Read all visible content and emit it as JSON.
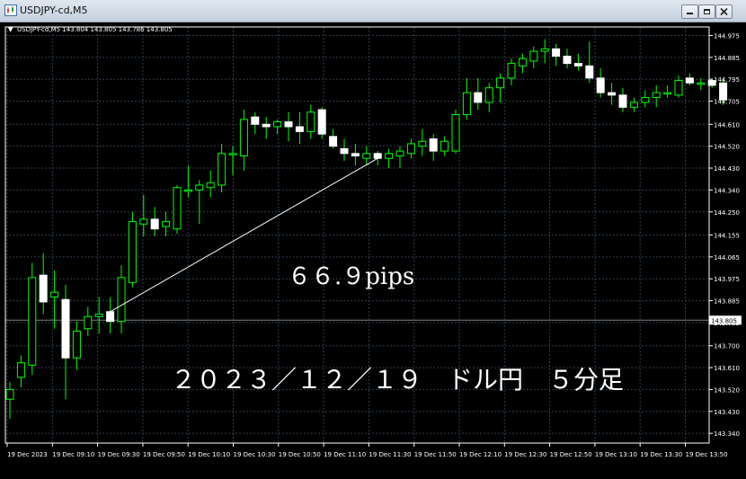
{
  "window": {
    "title": "USDJPY-cd,M5",
    "buttons": [
      "minimize",
      "restore",
      "close"
    ]
  },
  "colors": {
    "background": "#000000",
    "grid": "#2f3f4f",
    "bull_body": "#000000",
    "bull_edge": "#00ff00",
    "bear_body": "#ffffff",
    "wick": "#00ff00",
    "text": "#ffffff",
    "trendline": "#ffffff",
    "current_price_line": "#808080"
  },
  "symbol_info": {
    "arrow": "▼",
    "text": "USDJPY-cd,M5  143.804 143.805 143.786 143.805"
  },
  "annotations": {
    "pips": "６６.９pips",
    "caption": "２０２３／１２／１９　ドル円　５分足"
  },
  "current_price_label": "143.805",
  "chart_data": {
    "type": "candlestick",
    "title": "",
    "ylim": [
      143.3,
      145.01
    ],
    "y_ticks": [
      "144.975",
      "144.885",
      "144.795",
      "144.705",
      "144.610",
      "144.520",
      "144.430",
      "144.340",
      "144.250",
      "144.155",
      "144.065",
      "143.975",
      "143.885",
      "143.795",
      "143.700",
      "143.610",
      "143.520",
      "143.430",
      "143.340"
    ],
    "x_labels": [
      "19 Dec 2023",
      "19 Dec 09:10",
      "19 Dec 09:30",
      "19 Dec 09:50",
      "19 Dec 10:10",
      "19 Dec 10:30",
      "19 Dec 10:50",
      "19 Dec 11:10",
      "19 Dec 11:30",
      "19 Dec 11:50",
      "19 Dec 12:10",
      "19 Dec 12:30",
      "19 Dec 12:50",
      "19 Dec 13:10",
      "19 Dec 13:30",
      "19 Dec 13:50"
    ],
    "grid": true,
    "current_price": 143.805,
    "candles": [
      {
        "o": 143.48,
        "h": 143.55,
        "l": 143.4,
        "c": 143.52
      },
      {
        "o": 143.57,
        "h": 143.66,
        "l": 143.53,
        "c": 143.63
      },
      {
        "o": 143.62,
        "h": 144.04,
        "l": 143.58,
        "c": 143.98
      },
      {
        "o": 143.99,
        "h": 144.08,
        "l": 143.83,
        "c": 143.88
      },
      {
        "o": 143.9,
        "h": 144.01,
        "l": 143.77,
        "c": 143.92
      },
      {
        "o": 143.89,
        "h": 143.95,
        "l": 143.48,
        "c": 143.65
      },
      {
        "o": 143.65,
        "h": 143.8,
        "l": 143.6,
        "c": 143.76
      },
      {
        "o": 143.77,
        "h": 143.86,
        "l": 143.74,
        "c": 143.82
      },
      {
        "o": 143.82,
        "h": 143.9,
        "l": 143.75,
        "c": 143.83
      },
      {
        "o": 143.84,
        "h": 143.9,
        "l": 143.75,
        "c": 143.8
      },
      {
        "o": 143.8,
        "h": 144.03,
        "l": 143.75,
        "c": 143.98
      },
      {
        "o": 143.96,
        "h": 144.25,
        "l": 143.94,
        "c": 144.21
      },
      {
        "o": 144.2,
        "h": 144.32,
        "l": 144.15,
        "c": 144.22
      },
      {
        "o": 144.22,
        "h": 144.27,
        "l": 144.15,
        "c": 144.18
      },
      {
        "o": 144.19,
        "h": 144.25,
        "l": 144.15,
        "c": 144.21
      },
      {
        "o": 144.18,
        "h": 144.36,
        "l": 144.16,
        "c": 144.35
      },
      {
        "o": 144.34,
        "h": 144.44,
        "l": 144.31,
        "c": 144.34
      },
      {
        "o": 144.34,
        "h": 144.38,
        "l": 144.2,
        "c": 144.36
      },
      {
        "o": 144.35,
        "h": 144.42,
        "l": 144.31,
        "c": 144.37
      },
      {
        "o": 144.36,
        "h": 144.53,
        "l": 144.33,
        "c": 144.49
      },
      {
        "o": 144.49,
        "h": 144.52,
        "l": 144.4,
        "c": 144.49
      },
      {
        "o": 144.48,
        "h": 144.67,
        "l": 144.42,
        "c": 144.63
      },
      {
        "o": 144.64,
        "h": 144.66,
        "l": 144.57,
        "c": 144.61
      },
      {
        "o": 144.61,
        "h": 144.64,
        "l": 144.55,
        "c": 144.6
      },
      {
        "o": 144.6,
        "h": 144.63,
        "l": 144.57,
        "c": 144.62
      },
      {
        "o": 144.62,
        "h": 144.66,
        "l": 144.54,
        "c": 144.6
      },
      {
        "o": 144.6,
        "h": 144.66,
        "l": 144.53,
        "c": 144.58
      },
      {
        "o": 144.58,
        "h": 144.69,
        "l": 144.55,
        "c": 144.66
      },
      {
        "o": 144.67,
        "h": 144.68,
        "l": 144.55,
        "c": 144.57
      },
      {
        "o": 144.56,
        "h": 144.59,
        "l": 144.51,
        "c": 144.52
      },
      {
        "o": 144.51,
        "h": 144.55,
        "l": 144.46,
        "c": 144.49
      },
      {
        "o": 144.49,
        "h": 144.53,
        "l": 144.44,
        "c": 144.48
      },
      {
        "o": 144.47,
        "h": 144.52,
        "l": 144.44,
        "c": 144.49
      },
      {
        "o": 144.49,
        "h": 144.5,
        "l": 144.44,
        "c": 144.47
      },
      {
        "o": 144.47,
        "h": 144.51,
        "l": 144.43,
        "c": 144.49
      },
      {
        "o": 144.48,
        "h": 144.52,
        "l": 144.43,
        "c": 144.5
      },
      {
        "o": 144.49,
        "h": 144.55,
        "l": 144.47,
        "c": 144.53
      },
      {
        "o": 144.52,
        "h": 144.59,
        "l": 144.48,
        "c": 144.54
      },
      {
        "o": 144.55,
        "h": 144.57,
        "l": 144.46,
        "c": 144.5
      },
      {
        "o": 144.5,
        "h": 144.56,
        "l": 144.48,
        "c": 144.54
      },
      {
        "o": 144.5,
        "h": 144.67,
        "l": 144.49,
        "c": 144.65
      },
      {
        "o": 144.65,
        "h": 144.8,
        "l": 144.63,
        "c": 144.74
      },
      {
        "o": 144.74,
        "h": 144.8,
        "l": 144.67,
        "c": 144.7
      },
      {
        "o": 144.7,
        "h": 144.78,
        "l": 144.66,
        "c": 144.76
      },
      {
        "o": 144.76,
        "h": 144.82,
        "l": 144.7,
        "c": 144.8
      },
      {
        "o": 144.8,
        "h": 144.88,
        "l": 144.77,
        "c": 144.86
      },
      {
        "o": 144.85,
        "h": 144.9,
        "l": 144.82,
        "c": 144.88
      },
      {
        "o": 144.87,
        "h": 144.93,
        "l": 144.84,
        "c": 144.91
      },
      {
        "o": 144.91,
        "h": 144.96,
        "l": 144.86,
        "c": 144.92
      },
      {
        "o": 144.92,
        "h": 144.94,
        "l": 144.85,
        "c": 144.89
      },
      {
        "o": 144.89,
        "h": 144.92,
        "l": 144.84,
        "c": 144.86
      },
      {
        "o": 144.86,
        "h": 144.9,
        "l": 144.83,
        "c": 144.85
      },
      {
        "o": 144.85,
        "h": 144.95,
        "l": 144.78,
        "c": 144.8
      },
      {
        "o": 144.8,
        "h": 144.84,
        "l": 144.72,
        "c": 144.74
      },
      {
        "o": 144.74,
        "h": 144.78,
        "l": 144.69,
        "c": 144.73
      },
      {
        "o": 144.73,
        "h": 144.76,
        "l": 144.66,
        "c": 144.68
      },
      {
        "o": 144.68,
        "h": 144.72,
        "l": 144.66,
        "c": 144.7
      },
      {
        "o": 144.7,
        "h": 144.75,
        "l": 144.68,
        "c": 144.72
      },
      {
        "o": 144.72,
        "h": 144.77,
        "l": 144.68,
        "c": 144.74
      },
      {
        "o": 144.74,
        "h": 144.77,
        "l": 144.72,
        "c": 144.74
      },
      {
        "o": 144.73,
        "h": 144.81,
        "l": 144.72,
        "c": 144.79
      },
      {
        "o": 144.8,
        "h": 144.82,
        "l": 144.77,
        "c": 144.78
      },
      {
        "o": 144.78,
        "h": 144.8,
        "l": 144.75,
        "c": 144.78
      },
      {
        "o": 144.79,
        "h": 144.8,
        "l": 144.76,
        "c": 144.77
      },
      {
        "o": 144.78,
        "h": 144.8,
        "l": 144.69,
        "c": 144.71
      }
    ],
    "trendline": {
      "from": {
        "candle": 9,
        "price": 143.84
      },
      "to": {
        "candle": 33,
        "price": 144.47
      }
    }
  }
}
